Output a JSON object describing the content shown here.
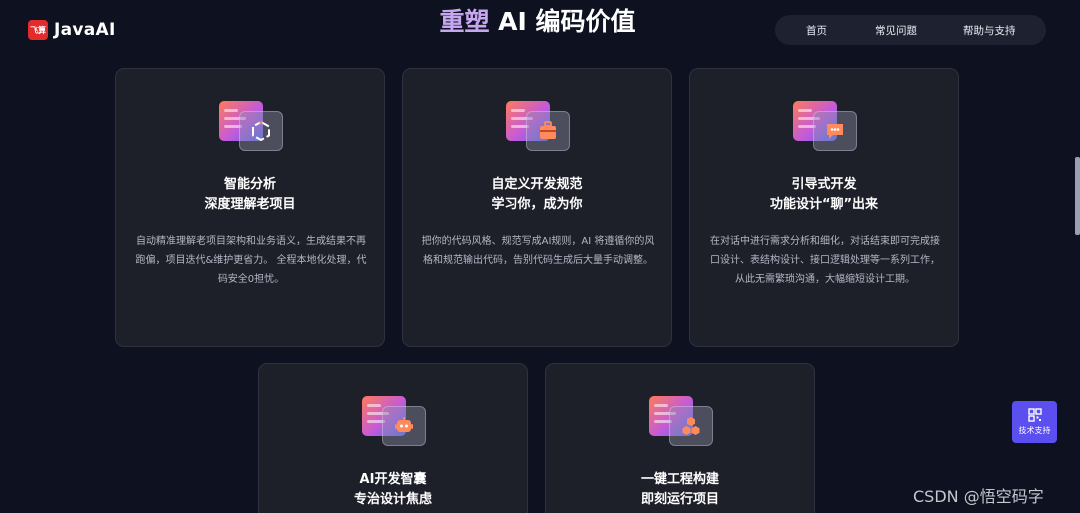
{
  "header": {
    "logo_badge": "飞算",
    "logo_text": "JavaAI",
    "title_accent": "重塑",
    "title_rest": " AI 编码价值"
  },
  "nav": {
    "items": [
      {
        "label": "首页"
      },
      {
        "label": "常见问题"
      },
      {
        "label": "帮助与支持"
      }
    ]
  },
  "cards": [
    {
      "title_line1": "智能分析",
      "title_line2": "深度理解老项目",
      "description": "自动精准理解老项目架构和业务语义，生成结果不再跑偏，项目迭代&维护更省力。 全程本地化处理，代码安全0担忧。",
      "icon": "hexagon-link-icon"
    },
    {
      "title_line1": "自定义开发规范",
      "title_line2": "学习你，成为你",
      "description": "把你的代码风格、规范写成AI规则，AI 将遵循你的风格和规范输出代码，告别代码生成后大量手动调整。",
      "icon": "toolbox-icon"
    },
    {
      "title_line1": "引导式开发",
      "title_line2": "功能设计“聊”出来",
      "description": "在对话中进行需求分析和细化，对话结束即可完成接口设计、表结构设计、接口逻辑处理等一系列工作，从此无需繁琐沟通，大幅缩短设计工期。",
      "icon": "chat-bubble-icon"
    },
    {
      "title_line1": "AI开发智囊",
      "title_line2": "专治设计焦虑",
      "description": "",
      "icon": "robot-icon"
    },
    {
      "title_line1": "一键工程构建",
      "title_line2": "即刻运行项目",
      "description": "",
      "icon": "cubes-icon"
    }
  ],
  "floating": {
    "support_label": "技术支持",
    "icon": "qr-code-icon"
  },
  "watermark": "CSDN @悟空码字",
  "colors": {
    "background": "#0d1120",
    "card": "#1e2029",
    "accent": "#5b4ff0",
    "brand_red": "#e32b2b"
  }
}
